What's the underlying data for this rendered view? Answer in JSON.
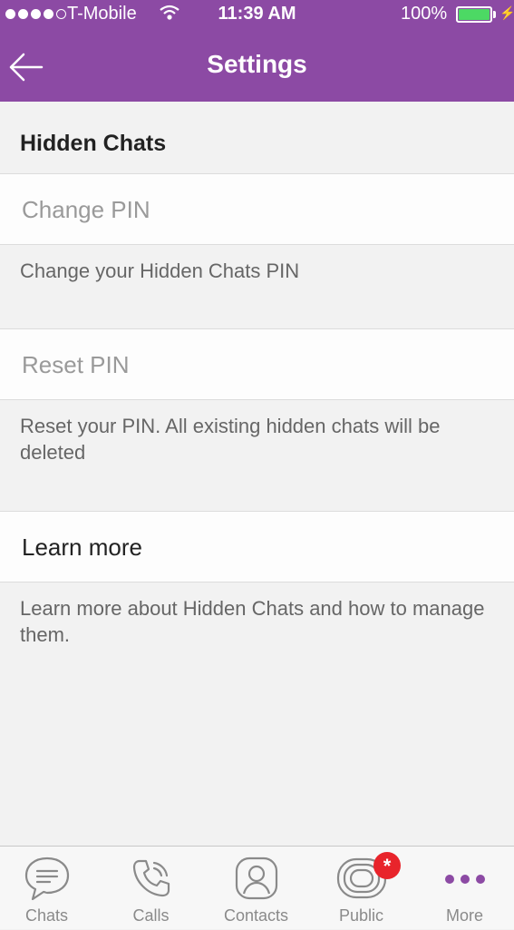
{
  "status_bar": {
    "carrier": "T-Mobile",
    "time": "11:39 AM",
    "battery": "100%",
    "battery_color": "#4cd964",
    "signal_bars_filled": 4,
    "signal_bars_total": 5
  },
  "nav": {
    "title": "Settings",
    "back_icon": "back-arrow-icon"
  },
  "section": {
    "title": "Hidden Chats"
  },
  "rows": [
    {
      "label": "Change PIN",
      "description": "Change your Hidden Chats PIN",
      "enabled": false
    },
    {
      "label": "Reset PIN",
      "description": "Reset your PIN. All existing hidden chats will be deleted",
      "enabled": false
    },
    {
      "label": "Learn more",
      "description": "Learn more about Hidden Chats and how to manage them.",
      "enabled": true
    }
  ],
  "tabs": [
    {
      "label": "Chats",
      "icon": "chat-bubble-icon"
    },
    {
      "label": "Calls",
      "icon": "phone-icon"
    },
    {
      "label": "Contacts",
      "icon": "contact-icon"
    },
    {
      "label": "Public",
      "icon": "public-icon",
      "badge": "*"
    },
    {
      "label": "More",
      "icon": "more-dots-icon",
      "active": true
    }
  ],
  "colors": {
    "brand": "#8c4aa4",
    "badge": "#e8242b"
  }
}
